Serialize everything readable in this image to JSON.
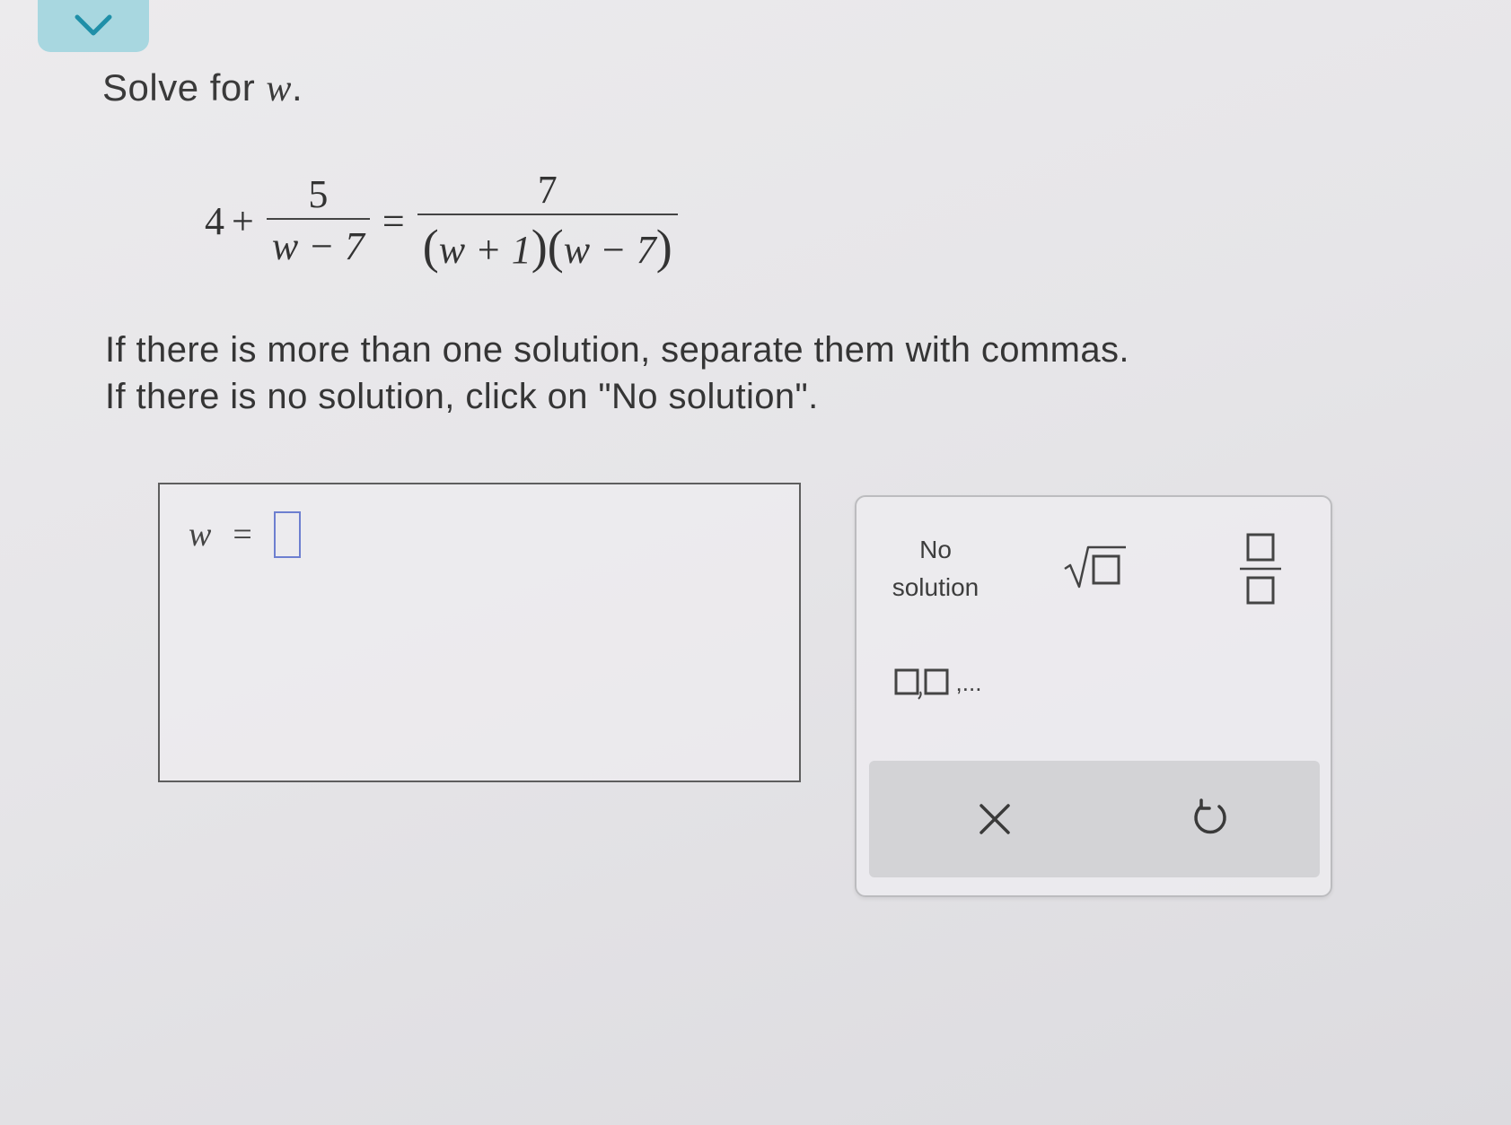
{
  "prompt": {
    "text": "Solve for ",
    "variable": "w",
    "period": "."
  },
  "equation": {
    "lhs_constant": "4",
    "plus": "+",
    "lhs_numerator": "5",
    "lhs_denominator": "w − 7",
    "equals": "=",
    "rhs_numerator": "7",
    "rhs_den_factor1_open": "(",
    "rhs_den_factor1": "w + 1",
    "rhs_den_factor1_close": ")",
    "rhs_den_factor2_open": "(",
    "rhs_den_factor2": "w − 7",
    "rhs_den_factor2_close": ")"
  },
  "instructions": {
    "line1": "If there is more than one solution, separate them with commas.",
    "line2": "If there is no solution, click on \"No solution\"."
  },
  "answer": {
    "variable": "w",
    "equals": "=",
    "value": ""
  },
  "keypad": {
    "no_solution_line1": "No",
    "no_solution_line2": "solution",
    "sqrt_icon": "square-root-icon",
    "fraction_icon": "fraction-icon",
    "list_ellipsis": ",...",
    "list_icon": "list-comma-icon",
    "clear_icon": "times-icon",
    "undo_icon": "undo-icon"
  },
  "colors": {
    "tab": "#a8d7e0",
    "tab_chevron": "#1f8fa8",
    "input_border": "#6d7fd0",
    "action_bar": "#d3d3d6"
  }
}
